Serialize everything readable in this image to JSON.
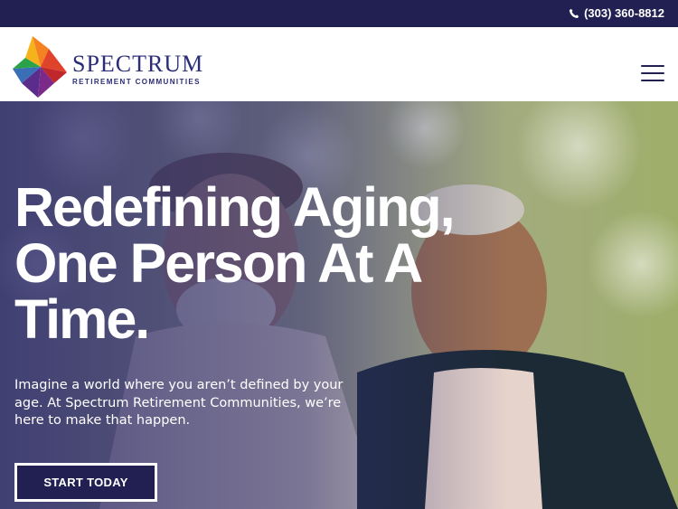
{
  "topbar": {
    "phone": "(303) 360-8812",
    "phone_icon": "phone-icon"
  },
  "header": {
    "logo_name": "SPECTRUM",
    "logo_subtitle": "RETIREMENT COMMUNITIES",
    "menu_icon": "hamburger-menu-icon"
  },
  "hero": {
    "headline": "Redefining Aging, One Person At A Time.",
    "subtext": "Imagine a world where you aren’t defined by your age. At Spectrum Retirement Communities, we’re here to make that happen.",
    "cta_label": "START TODAY"
  },
  "colors": {
    "brand_navy": "#222052",
    "logo_text": "#2b2d78"
  }
}
